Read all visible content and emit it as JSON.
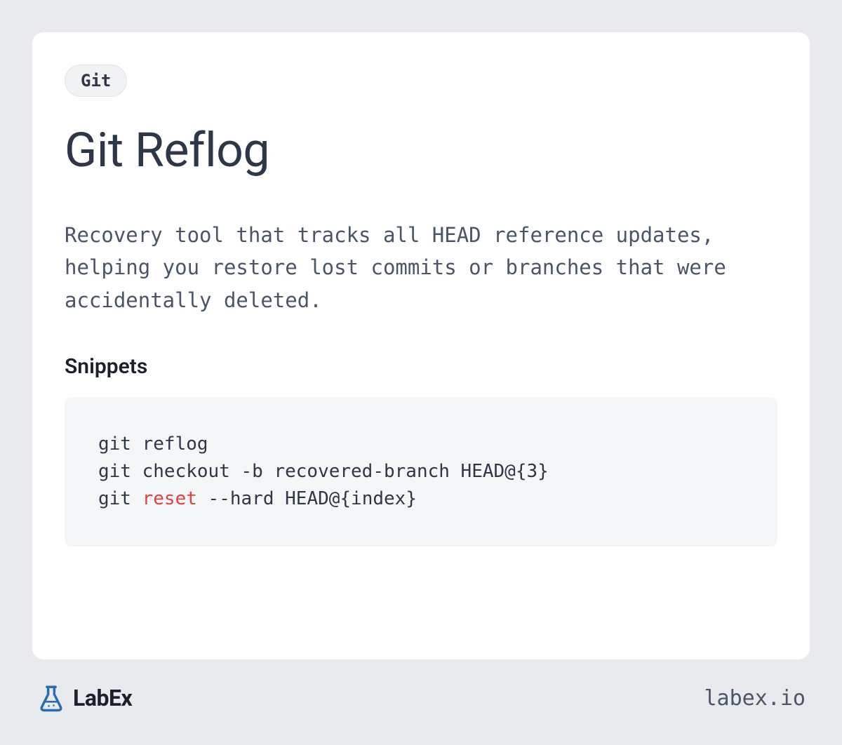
{
  "card": {
    "tag": "Git",
    "title": "Git Reflog",
    "description": "Recovery tool that tracks all HEAD reference updates, helping you restore lost commits or branches that were accidentally deleted.",
    "snippets_heading": "Snippets",
    "code": {
      "line1": "git reflog",
      "line2": "git checkout -b recovered-branch HEAD@{3}",
      "line3_prefix": "git ",
      "line3_keyword": "reset",
      "line3_suffix": " --hard HEAD@{index}"
    }
  },
  "footer": {
    "brand": "LabEx",
    "url": "labex.io"
  }
}
